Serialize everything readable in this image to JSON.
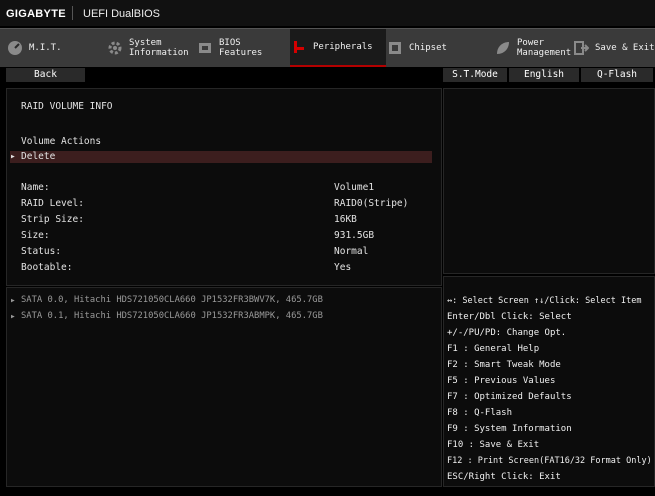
{
  "topbar": {
    "brand": "GIGABYTE",
    "mode": "UEFI DualBIOS"
  },
  "menu": {
    "tabs": [
      {
        "label": "M.I.T.",
        "icon": "gauge-icon"
      },
      {
        "label": "System\nInformation",
        "icon": "gear-icon"
      },
      {
        "label": "BIOS\nFeatures",
        "icon": "bios-chip-icon"
      },
      {
        "label": "Peripherals",
        "icon": "plug-icon",
        "active": true
      },
      {
        "label": "Chipset",
        "icon": "chipset-icon"
      },
      {
        "label": "Power\nManagement",
        "icon": "leaf-icon"
      },
      {
        "label": "Save & Exit",
        "icon": "exit-icon"
      }
    ]
  },
  "subbar": {
    "back": "Back",
    "stmode": "S.T.Mode",
    "language": "English",
    "qflash": "Q-Flash"
  },
  "main": {
    "section_title": "RAID VOLUME INFO",
    "actions_title": "Volume Actions",
    "delete_label": "Delete",
    "fields": [
      {
        "label": "Name:",
        "value": "Volume1"
      },
      {
        "label": "RAID Level:",
        "value": "RAID0(Stripe)"
      },
      {
        "label": "Strip Size:",
        "value": "16KB"
      },
      {
        "label": "Size:",
        "value": "931.5GB"
      },
      {
        "label": "Status:",
        "value": "Normal"
      },
      {
        "label": "Bootable:",
        "value": "Yes"
      }
    ],
    "disks": [
      "SATA 0.0, Hitachi HDS721050CLA660 JP1532FR3BWV7K, 465.7GB",
      "SATA 0.1, Hitachi HDS721050CLA660 JP1532FR3ABMPK, 465.7GB"
    ]
  },
  "help": [
    "↔: Select Screen  ↑↓/Click: Select Item",
    "Enter/Dbl Click: Select",
    "+/-/PU/PD: Change Opt.",
    "F1  : General Help",
    "F2  : Smart Tweak Mode",
    "F5  : Previous Values",
    "F7  : Optimized Defaults",
    "F8  : Q-Flash",
    "F9  : System Information",
    "F10 : Save & Exit",
    "F12 : Print Screen(FAT16/32 Format Only)",
    "ESC/Right Click: Exit"
  ],
  "colors": {
    "accent": "#b40000",
    "highlight": "#3c1e1e",
    "panel": "#0c0c0c"
  }
}
